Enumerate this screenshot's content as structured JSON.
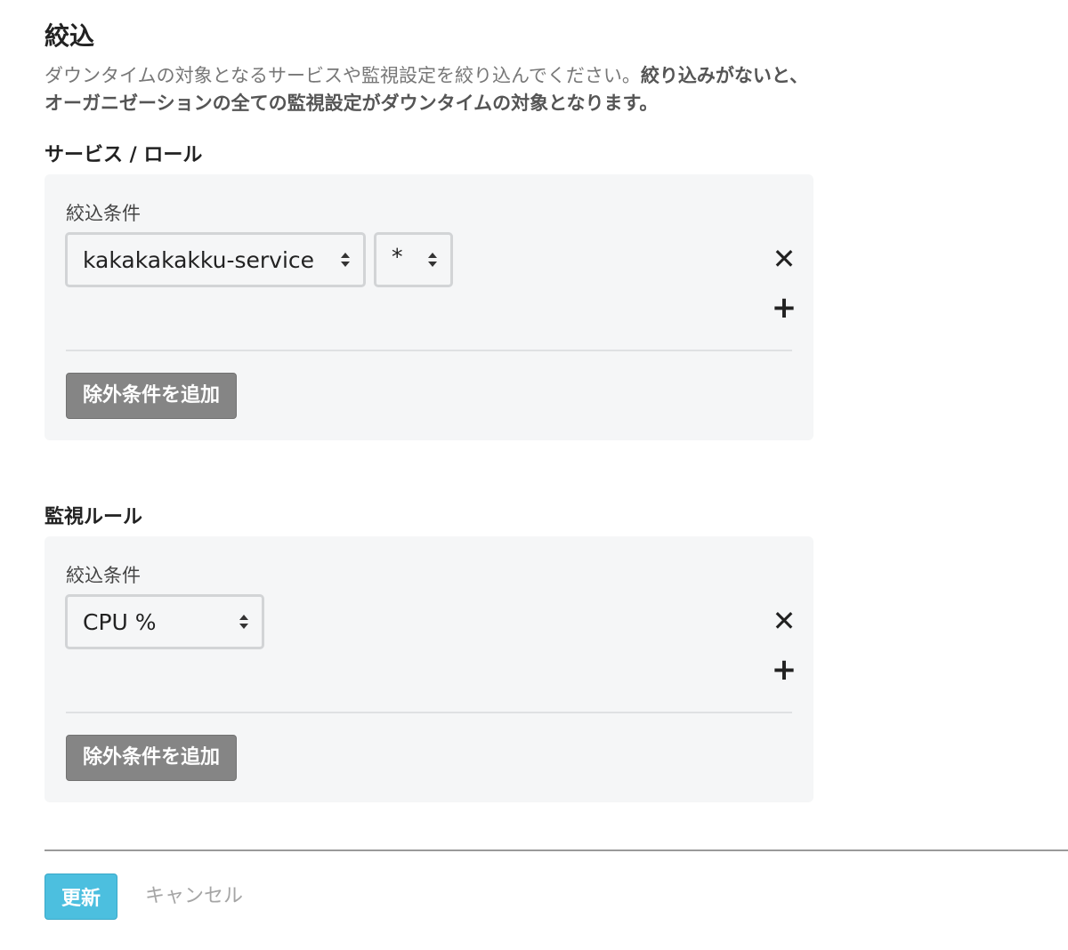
{
  "filter": {
    "title": "絞込",
    "description_normal": "ダウンタイムの対象となるサービスや監視設定を絞り込んでください。",
    "description_bold": "絞り込みがないと、オーガニゼーションの全ての監視設定がダウンタイムの対象となります。"
  },
  "service_section": {
    "title": "サービス / ロール",
    "condition_label": "絞込条件",
    "service_select_value": "kakakakakku-service",
    "role_select_value": "*",
    "remove_symbol": "✕",
    "add_symbol": "+",
    "exclude_button_label": "除外条件を追加"
  },
  "monitor_section": {
    "title": "監視ルール",
    "condition_label": "絞込条件",
    "monitor_select_value": "CPU %",
    "remove_symbol": "✕",
    "add_symbol": "+",
    "exclude_button_label": "除外条件を追加"
  },
  "footer": {
    "update_label": "更新",
    "cancel_label": "キャンセル"
  },
  "colors": {
    "primary": "#4cbfdf",
    "secondary_button": "#858585",
    "panel_background": "#f5f6f7"
  }
}
